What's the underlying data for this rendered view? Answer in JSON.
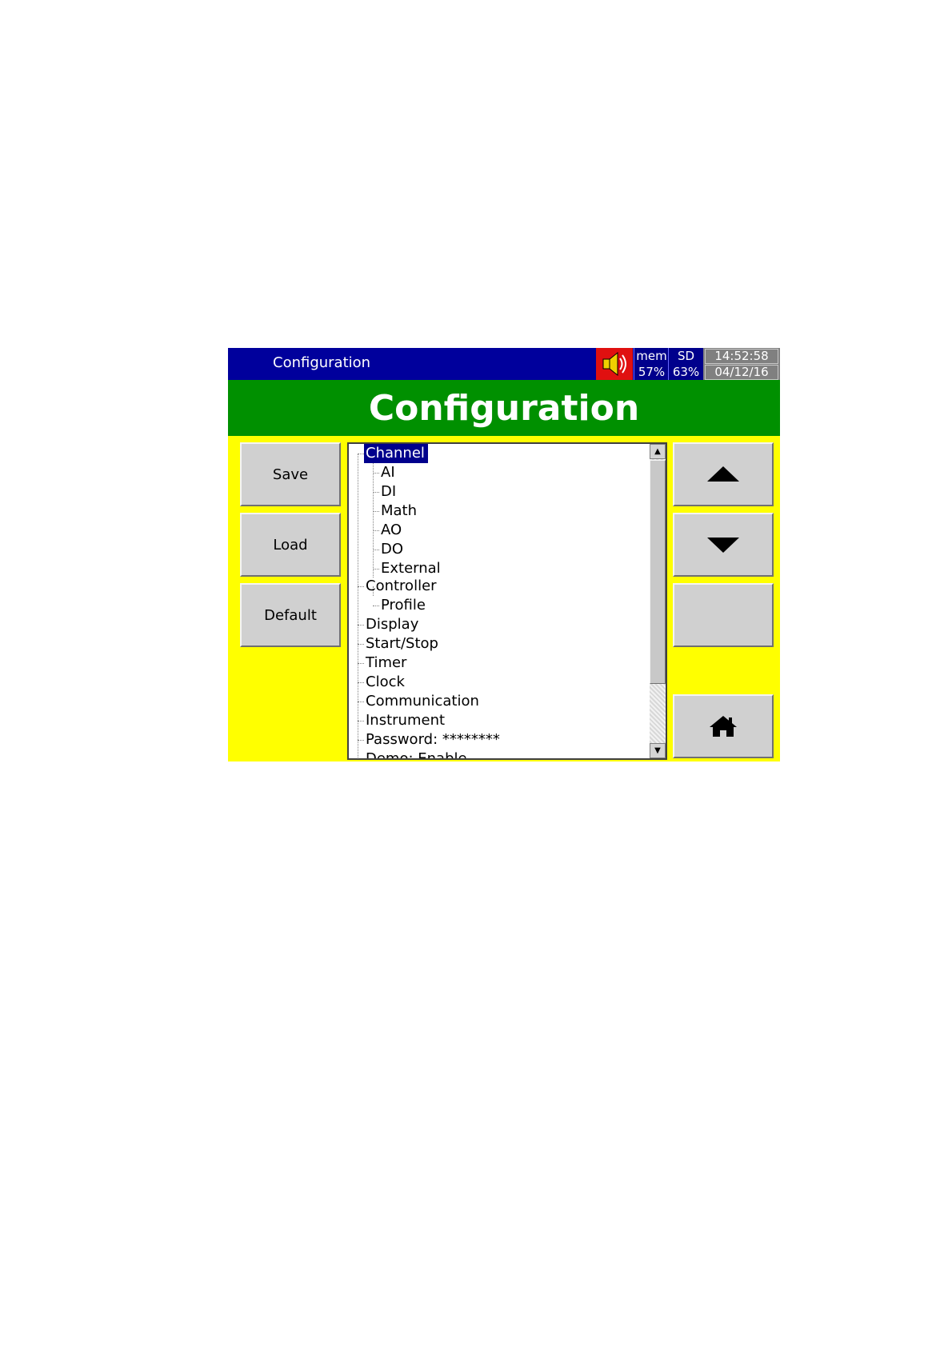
{
  "window": {
    "title": "Configuration"
  },
  "status": {
    "mem_label": "mem",
    "mem_value": "57%",
    "sd_label": "SD",
    "sd_value": "63%",
    "time": "14:52:58",
    "date": "04/12/16"
  },
  "banner": {
    "title": "Configuration"
  },
  "buttons": {
    "save": "Save",
    "load": "Load",
    "default": "Default"
  },
  "nav_icons": {
    "up": "triangle-up-icon",
    "down": "triangle-down-icon",
    "home": "home-icon",
    "speaker": "speaker-icon"
  },
  "tree": {
    "items": [
      "Channel",
      "AI",
      "DI",
      "Math",
      "AO",
      "DO",
      "External",
      "Controller",
      "Profile",
      "Display",
      "Start/Stop",
      "Timer",
      "Clock",
      "Communication",
      "Instrument",
      "Password: ********",
      "Demo: Enable"
    ],
    "selected": "Channel"
  },
  "colors": {
    "titlebar": "#00009c",
    "banner": "#009000",
    "background": "#ffff00",
    "selection": "#00008c",
    "speaker_bg": "#e01010"
  }
}
